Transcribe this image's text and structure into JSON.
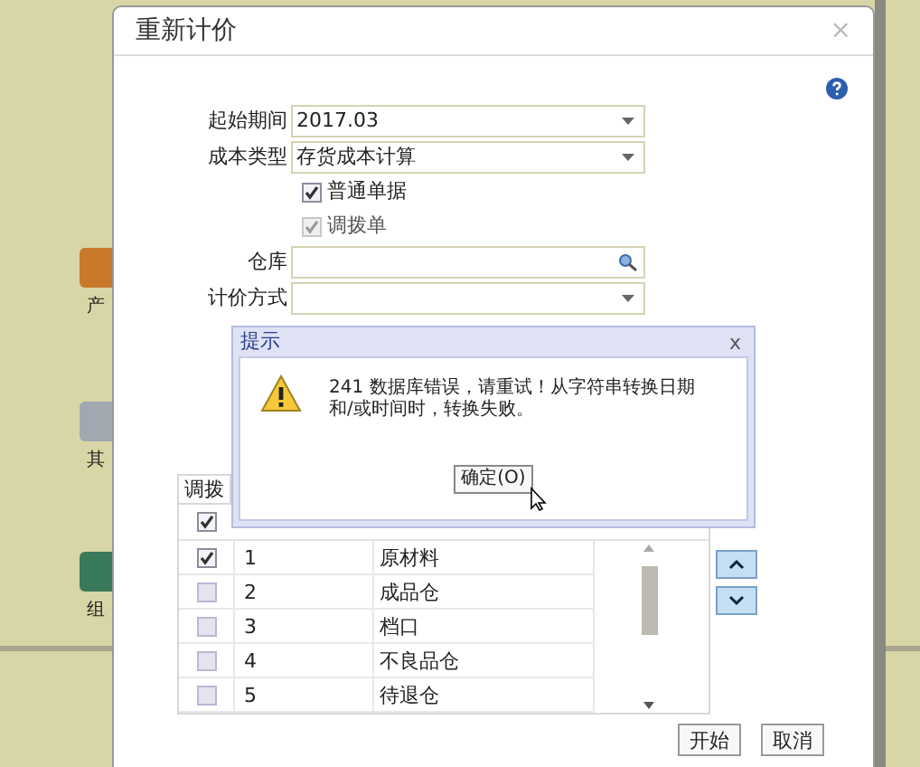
{
  "desktop_icons": [
    {
      "label": "产"
    },
    {
      "label": "其"
    },
    {
      "label": "组"
    }
  ],
  "dialog": {
    "title": "重新计价",
    "close": "×",
    "fields": [
      {
        "kind": "select",
        "label": "起始期间",
        "value": "2017.03"
      },
      {
        "kind": "select",
        "label": "成本类型",
        "value": "存货成本计算"
      },
      {
        "kind": "checkbox",
        "label": "普通单据",
        "checked": true,
        "disabled": false
      },
      {
        "kind": "checkbox",
        "label": "调拨单",
        "checked": true,
        "disabled": true
      },
      {
        "kind": "lookup",
        "label": "仓库"
      },
      {
        "kind": "select",
        "label": "计价方式"
      }
    ],
    "table": {
      "tab": "调拨",
      "select_all_checked": true,
      "rows": [
        {
          "checked": true,
          "no": "1",
          "name": "原材料"
        },
        {
          "checked": false,
          "no": "2",
          "name": "成品仓"
        },
        {
          "checked": false,
          "no": "3",
          "name": "档口"
        },
        {
          "checked": false,
          "no": "4",
          "name": "不良品仓"
        },
        {
          "checked": false,
          "no": "5",
          "name": "待退仓"
        }
      ]
    },
    "buttons": [
      "开始",
      "取消"
    ]
  },
  "message_box": {
    "title": "提示",
    "close": "x",
    "message": "241 数据库错误，请重试！从字符串转换日期和/或时间时，转换失败。",
    "button": "确定(O)"
  }
}
